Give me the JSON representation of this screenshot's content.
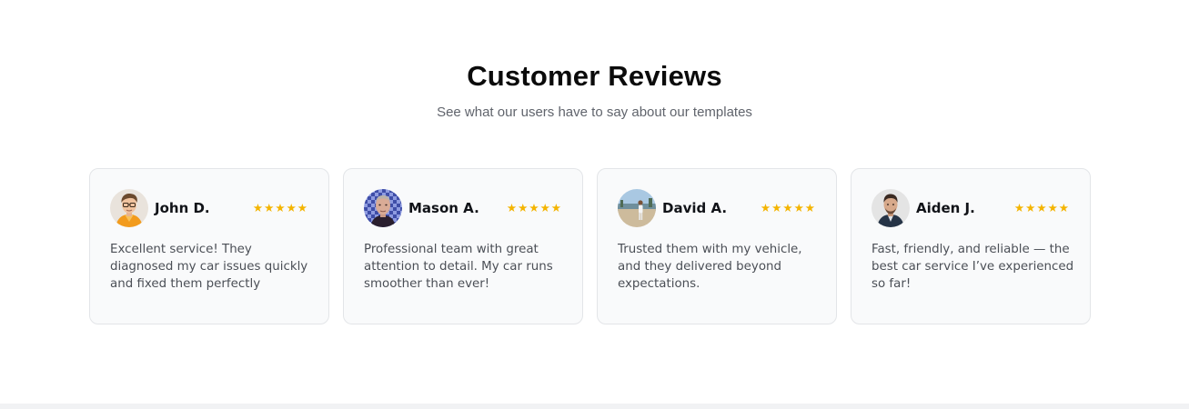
{
  "section": {
    "title": "Customer Reviews",
    "subtitle": "See what our users have to say about our templates"
  },
  "colors": {
    "star": "#f4b400",
    "card_background": "#f9fafb",
    "card_border": "#e3e5e8",
    "title": "#0b0b0b",
    "body_text": "#4b4f56"
  },
  "reviews": [
    {
      "name": "John D.",
      "rating": 5,
      "stars": "★★★★★",
      "text": "Excellent service! They diagnosed my car issues quickly and fixed them perfectly",
      "avatar_icon": "avatar-john-icon"
    },
    {
      "name": "Mason A.",
      "rating": 5,
      "stars": "★★★★★",
      "text": "Professional team with great attention to detail. My car runs smoother than ever!",
      "avatar_icon": "avatar-mason-icon"
    },
    {
      "name": "David A.",
      "rating": 5,
      "stars": "★★★★★",
      "text": "Trusted them with my vehicle, and they delivered beyond expectations.",
      "avatar_icon": "avatar-david-icon"
    },
    {
      "name": "Aiden J.",
      "rating": 5,
      "stars": "★★★★★",
      "text": "Fast, friendly, and reliable — the best car service I’ve experienced so far!",
      "avatar_icon": "avatar-aiden-icon"
    }
  ]
}
